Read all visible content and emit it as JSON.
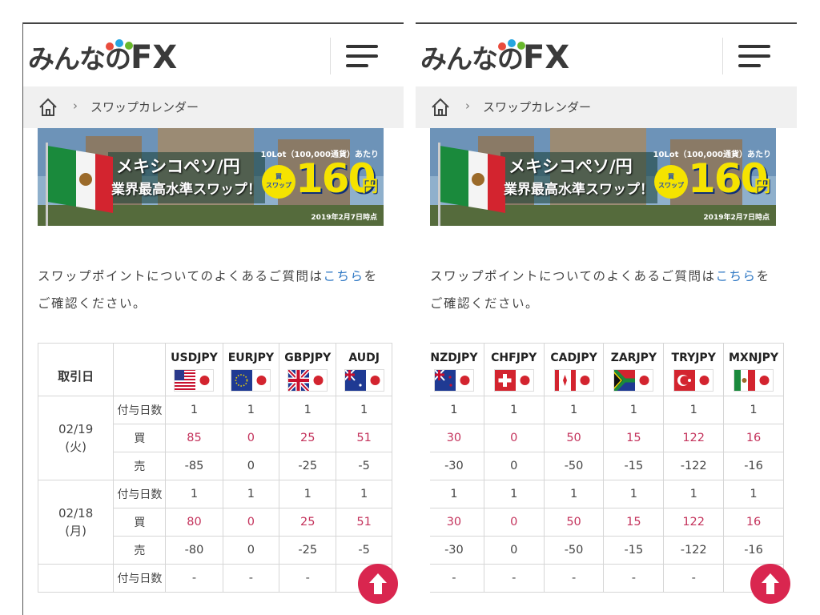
{
  "logo": {
    "text": "みんなの",
    "fx": "FX",
    "dot_colors": [
      "#e94c3d",
      "#26a6e0",
      "#68b82c"
    ]
  },
  "breadcrumb": {
    "separator": "›",
    "current": "スワップカレンダー"
  },
  "banner": {
    "note": "10Lot（100,000通貨）あたり",
    "title_line1": "メキシコペソ/円",
    "title_line2": "業界最高水準スワップ！",
    "badge": "買\nスワップ",
    "amount": "160",
    "unit": "円",
    "date": "2019年2月7日時点"
  },
  "intro": {
    "text_before": "スワップポイントについてのよくあるご質問は",
    "link": "こちら",
    "text_after": "をご確認ください。"
  },
  "table": {
    "date_header": "取引日",
    "row_labels": {
      "days": "付与日数",
      "buy": "買",
      "sell": "売"
    },
    "left_pairs": [
      {
        "name": "USDJPY",
        "flag": "us"
      },
      {
        "name": "EURJPY",
        "flag": "eu"
      },
      {
        "name": "GBPJPY",
        "flag": "gb"
      },
      {
        "name": "AUDJ",
        "flag": "au"
      }
    ],
    "right_pairs": [
      {
        "name": "NZDJPY",
        "flag": "nz"
      },
      {
        "name": "CHFJPY",
        "flag": "ch"
      },
      {
        "name": "CADJPY",
        "flag": "ca"
      },
      {
        "name": "ZARJPY",
        "flag": "za"
      },
      {
        "name": "TRYJPY",
        "flag": "tr"
      },
      {
        "name": "MXNJPY",
        "flag": "mx"
      }
    ],
    "dates": [
      {
        "date": "02/19",
        "weekday": "(火)",
        "left": {
          "days": [
            "1",
            "1",
            "1",
            "1"
          ],
          "buy": [
            "85",
            "0",
            "25",
            "51"
          ],
          "sell": [
            "-85",
            "0",
            "-25",
            "-5"
          ]
        },
        "right": {
          "days": [
            "1",
            "1",
            "1",
            "1",
            "1",
            "1"
          ],
          "buy": [
            "30",
            "0",
            "50",
            "15",
            "122",
            "16"
          ],
          "sell": [
            "-30",
            "0",
            "-50",
            "-15",
            "-122",
            "-16"
          ]
        }
      },
      {
        "date": "02/18",
        "weekday": "(月)",
        "left": {
          "days": [
            "1",
            "1",
            "1",
            "1"
          ],
          "buy": [
            "80",
            "0",
            "25",
            "51"
          ],
          "sell": [
            "-80",
            "0",
            "-25",
            "-5"
          ]
        },
        "right": {
          "days": [
            "1",
            "1",
            "1",
            "1",
            "1",
            "1"
          ],
          "buy": [
            "30",
            "0",
            "50",
            "15",
            "122",
            "16"
          ],
          "sell": [
            "-30",
            "0",
            "-50",
            "-15",
            "-122",
            "-16"
          ]
        }
      },
      {
        "date": "",
        "weekday": "",
        "left": {
          "days": [
            "-",
            "-",
            "-",
            "-"
          ]
        },
        "right": {
          "days": [
            "-",
            "-",
            "-",
            "-",
            "-",
            "-"
          ]
        }
      }
    ]
  },
  "colors": {
    "buy": "#c4335c",
    "link": "#2f78c4",
    "scroll_button": "#d9264f",
    "breadcrumb_bg": "#f0f0f0"
  },
  "icons": {
    "home": "home-icon",
    "menu": "hamburger-menu-icon",
    "scroll_top": "arrow-up-icon"
  }
}
